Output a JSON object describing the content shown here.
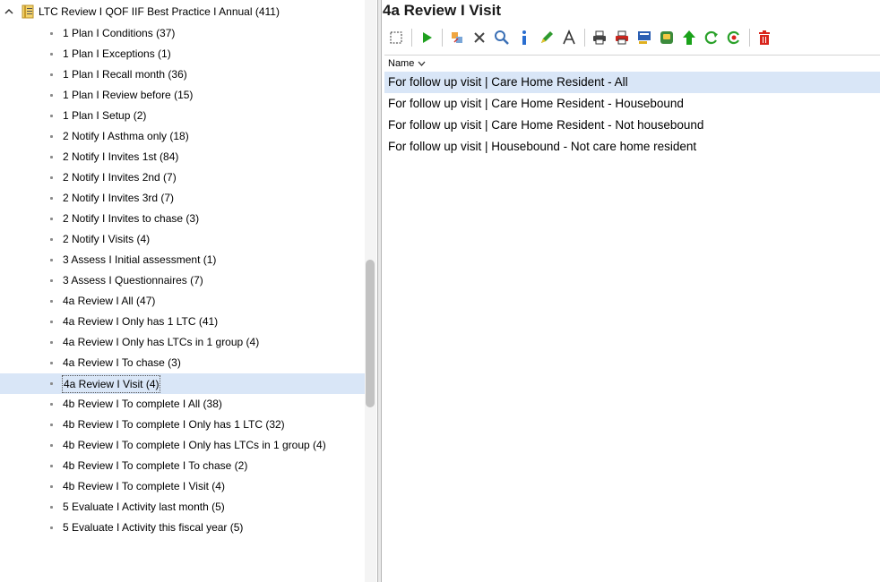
{
  "tree": {
    "root_label": "LTC Review I QOF IIF Best Practice I Annual (411)",
    "selected_index": 15,
    "items": [
      "1 Plan I Conditions (37)",
      "1 Plan I Exceptions (1)",
      "1 Plan I Recall month (36)",
      "1 Plan I Review before (15)",
      "1 Plan I Setup (2)",
      "2 Notify I Asthma only (18)",
      "2 Notify I Invites 1st (84)",
      "2 Notify I Invites 2nd (7)",
      "2 Notify I Invites 3rd (7)",
      "2 Notify I Invites to chase (3)",
      "2 Notify I Visits (4)",
      "3 Assess I Initial assessment (1)",
      "3 Assess I Questionnaires (7)",
      "4a Review I All (47)",
      "4a Review I Only has 1 LTC (41)",
      "4a Review I Only has LTCs in 1 group (4)",
      "4a Review I To chase (3)",
      "4a Review I Visit (4)",
      "4b Review I To complete I All (38)",
      "4b Review I To complete I Only has 1 LTC (32)",
      "4b Review I To complete I Only has LTCs in 1 group (4)",
      "4b Review I To complete I To chase (2)",
      "4b Review I To complete I Visit (4)",
      "5 Evaluate I Activity last month (5)",
      "5 Evaluate I Activity this fiscal year (5)"
    ]
  },
  "panel": {
    "title": "4a Review I Visit",
    "column_header": "Name",
    "rows": [
      "For follow up visit | Care Home Resident - All",
      "For follow up visit | Care Home Resident - Housebound",
      "For follow up visit | Care Home Resident - Not housebound",
      "For follow up visit | Housebound - Not care home resident"
    ],
    "selected_row": 0
  },
  "toolbar_icons": [
    "select-icon",
    "run-icon",
    "merge-icon",
    "delete-x-icon",
    "search-icon",
    "info-icon",
    "highlight-icon",
    "font-icon",
    "print-icon",
    "print-red-icon",
    "export-icon",
    "save-icon",
    "upload-icon",
    "refresh-icon",
    "refresh-alt-icon",
    "trash-icon"
  ],
  "colors": {
    "selection": "#d9e6f7",
    "accent_green": "#1fa01f",
    "delete_red": "#d9241c"
  }
}
